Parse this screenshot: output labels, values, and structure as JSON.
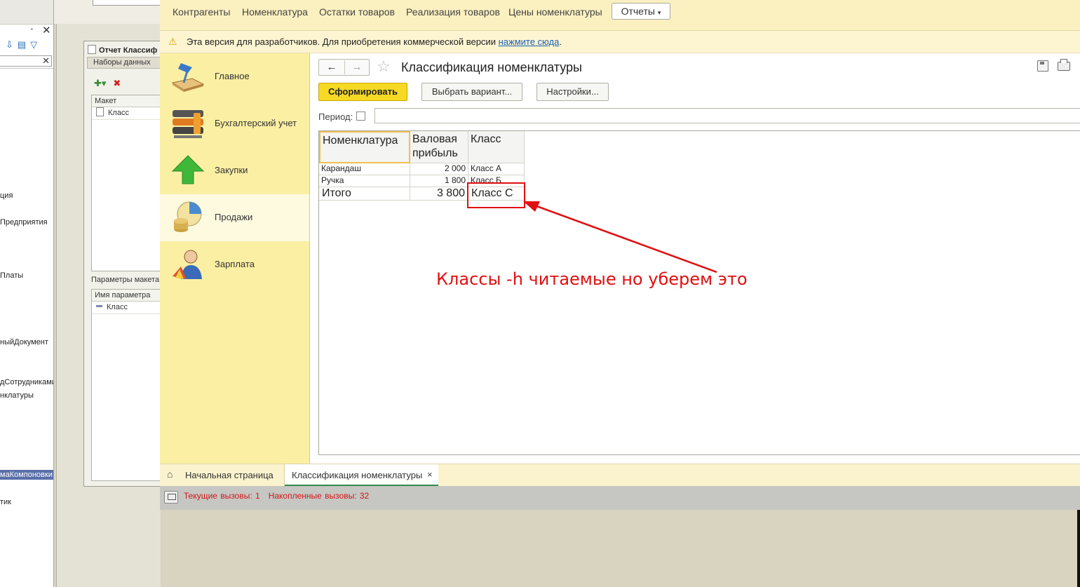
{
  "background_designer": {
    "tree_items": [
      "ция",
      "Предприятия",
      "Платы",
      "ныйДокумент",
      "дСотрудниками",
      "нклатуры",
      "маКомпоновки",
      "тик"
    ],
    "form_title": "Отчет Классиф",
    "tab_datasets": "Наборы данных",
    "grid1_header": "Макет",
    "grid1_row": "Класс",
    "params_label": "Параметры макета",
    "grid2_header": "Имя параметра",
    "grid2_row": "Класс"
  },
  "top_nav": {
    "links": [
      "Контрагенты",
      "Номенклатура",
      "Остатки товаров",
      "Реализация товаров",
      "Цены номенклатуры"
    ],
    "reports_button": "Отчеты"
  },
  "warning": {
    "text": "Эта версия для разработчиков. Для приобретения коммерческой версии",
    "link": "нажмите сюда",
    "tail": "."
  },
  "sections": [
    {
      "label": "Главное",
      "icon": "desk-lamp-icon"
    },
    {
      "label": "Бухгалтерский учет",
      "icon": "binders-icon"
    },
    {
      "label": "Закупки",
      "icon": "green-up-arrow-icon"
    },
    {
      "label": "Продажи",
      "icon": "pie-coins-icon",
      "active": true
    },
    {
      "label": "Зарплата",
      "icon": "person-palette-icon"
    }
  ],
  "report": {
    "title": "Классификация номенклатуры",
    "buttons": {
      "generate": "Сформировать",
      "variant": "Выбрать вариант...",
      "settings": "Настройки..."
    },
    "period_label": "Период:",
    "table": {
      "headers": {
        "nom": "Номенклатура",
        "profit": "Валовая прибыль",
        "class": "Класс"
      },
      "rows": [
        {
          "nom": "Карандаш",
          "profit": "2 000",
          "class": "Класс А"
        },
        {
          "nom": "Ручка",
          "profit": "1 800",
          "class": "Класс Б"
        }
      ],
      "total": {
        "nom": "Итого",
        "profit": "3 800",
        "class": "Класс С"
      }
    }
  },
  "annotation": {
    "text": "Классы -h читаемые но уберем это",
    "color": "#e01010"
  },
  "bottom_tabs": {
    "home": "Начальная страница",
    "report": "Классификация номенклатуры",
    "close": "×"
  },
  "status": {
    "current": "Текущие вызовы: 1",
    "accumulated": "Накопленные вызовы: 32"
  },
  "colors": {
    "accent_yellow": "#f5d924",
    "section_bg": "#fbefa3",
    "nav_bg": "#fbf0c0",
    "status_red": "#d01818"
  }
}
